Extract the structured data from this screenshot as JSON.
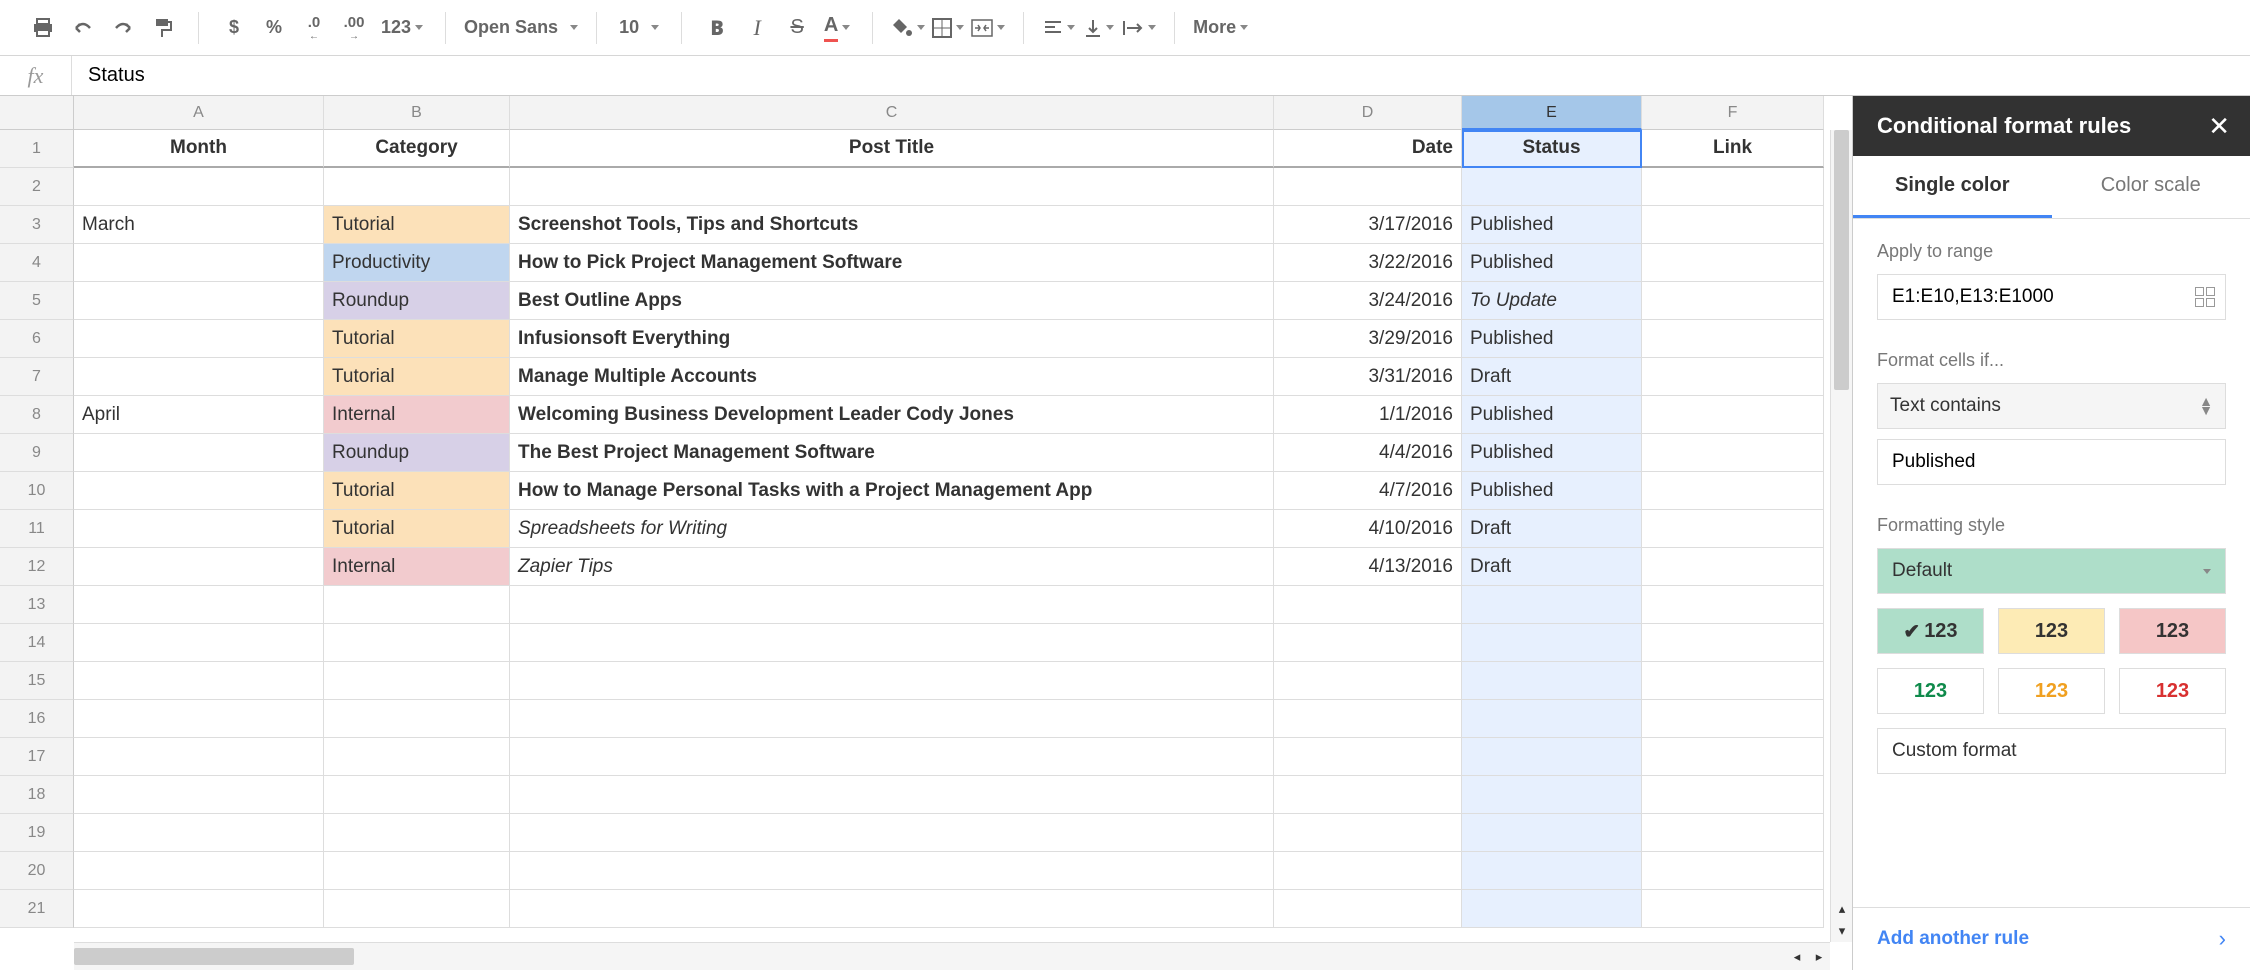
{
  "toolbar": {
    "format_dollar": "$",
    "format_percent": "%",
    "dec_decrease": ".0",
    "dec_increase": ".00",
    "format_123": "123",
    "font_name": "Open Sans",
    "font_size": "10",
    "bold": "B",
    "italic": "I",
    "strike": "S",
    "textcolor": "A",
    "more": "More"
  },
  "formula": {
    "fx": "fx",
    "value": "Status"
  },
  "columns": [
    "A",
    "B",
    "C",
    "D",
    "E",
    "F"
  ],
  "headers": {
    "month": "Month",
    "category": "Category",
    "title": "Post Title",
    "date": "Date",
    "status": "Status",
    "link": "Link"
  },
  "rows": [
    {
      "n": 1,
      "month": "Month",
      "category": "Category",
      "title": "Post Title",
      "date": "Date",
      "status": "Status",
      "link": "Link",
      "hdr": true
    },
    {
      "n": 2
    },
    {
      "n": 3,
      "month": "March",
      "category": "Tutorial",
      "cat": "tutorial",
      "title": "Screenshot Tools, Tips and Shortcuts",
      "date": "3/17/2016",
      "status": "Published",
      "st": "published",
      "bold": true
    },
    {
      "n": 4,
      "category": "Productivity",
      "cat": "productivity",
      "title": "How to Pick Project Management Software",
      "date": "3/22/2016",
      "status": "Published",
      "st": "published",
      "bold": true
    },
    {
      "n": 5,
      "category": "Roundup",
      "cat": "roundup",
      "title": "Best Outline Apps",
      "date": "3/24/2016",
      "status": "To Update",
      "st": "toupdate",
      "bold": true
    },
    {
      "n": 6,
      "category": "Tutorial",
      "cat": "tutorial",
      "title": "Infusionsoft Everything",
      "date": "3/29/2016",
      "status": "Published",
      "st": "published",
      "bold": true
    },
    {
      "n": 7,
      "category": "Tutorial",
      "cat": "tutorial",
      "title": "Manage Multiple Accounts",
      "date": "3/31/2016",
      "status": "Draft",
      "st": "draft",
      "bold": true
    },
    {
      "n": 8,
      "month": "April",
      "category": "Internal",
      "cat": "internal",
      "title": "Welcoming Business Development Leader Cody Jones",
      "date": "1/1/2016",
      "status": "Published",
      "st": "published",
      "bold": true
    },
    {
      "n": 9,
      "category": "Roundup",
      "cat": "roundup",
      "title": "The Best Project Management Software",
      "date": "4/4/2016",
      "status": "Published",
      "st": "published",
      "bold": true
    },
    {
      "n": 10,
      "category": "Tutorial",
      "cat": "tutorial",
      "title": "How to Manage Personal Tasks with a Project Management App",
      "date": "4/7/2016",
      "status": "Published",
      "st": "published",
      "bold": true
    },
    {
      "n": 11,
      "category": "Tutorial",
      "cat": "tutorial",
      "title": "Spreadsheets for Writing",
      "date": "4/10/2016",
      "status": "Draft",
      "st": "draft",
      "italic": true
    },
    {
      "n": 12,
      "category": "Internal",
      "cat": "internal",
      "title": "Zapier Tips",
      "date": "4/13/2016",
      "status": "Draft",
      "st": "draft",
      "italic": true
    },
    {
      "n": 13
    },
    {
      "n": 14
    },
    {
      "n": 15
    },
    {
      "n": 16
    },
    {
      "n": 17
    },
    {
      "n": 18
    },
    {
      "n": 19
    },
    {
      "n": 20
    },
    {
      "n": 21
    }
  ],
  "panel": {
    "title": "Conditional format rules",
    "tab_single": "Single color",
    "tab_scale": "Color scale",
    "apply_label": "Apply to range",
    "apply_value": "E1:E10,E13:E1000",
    "format_if_label": "Format cells if...",
    "condition": "Text contains",
    "condition_value": "Published",
    "style_label": "Formatting style",
    "style_value": "Default",
    "chip_text": "123",
    "custom": "Custom format",
    "add_rule": "Add another rule"
  }
}
